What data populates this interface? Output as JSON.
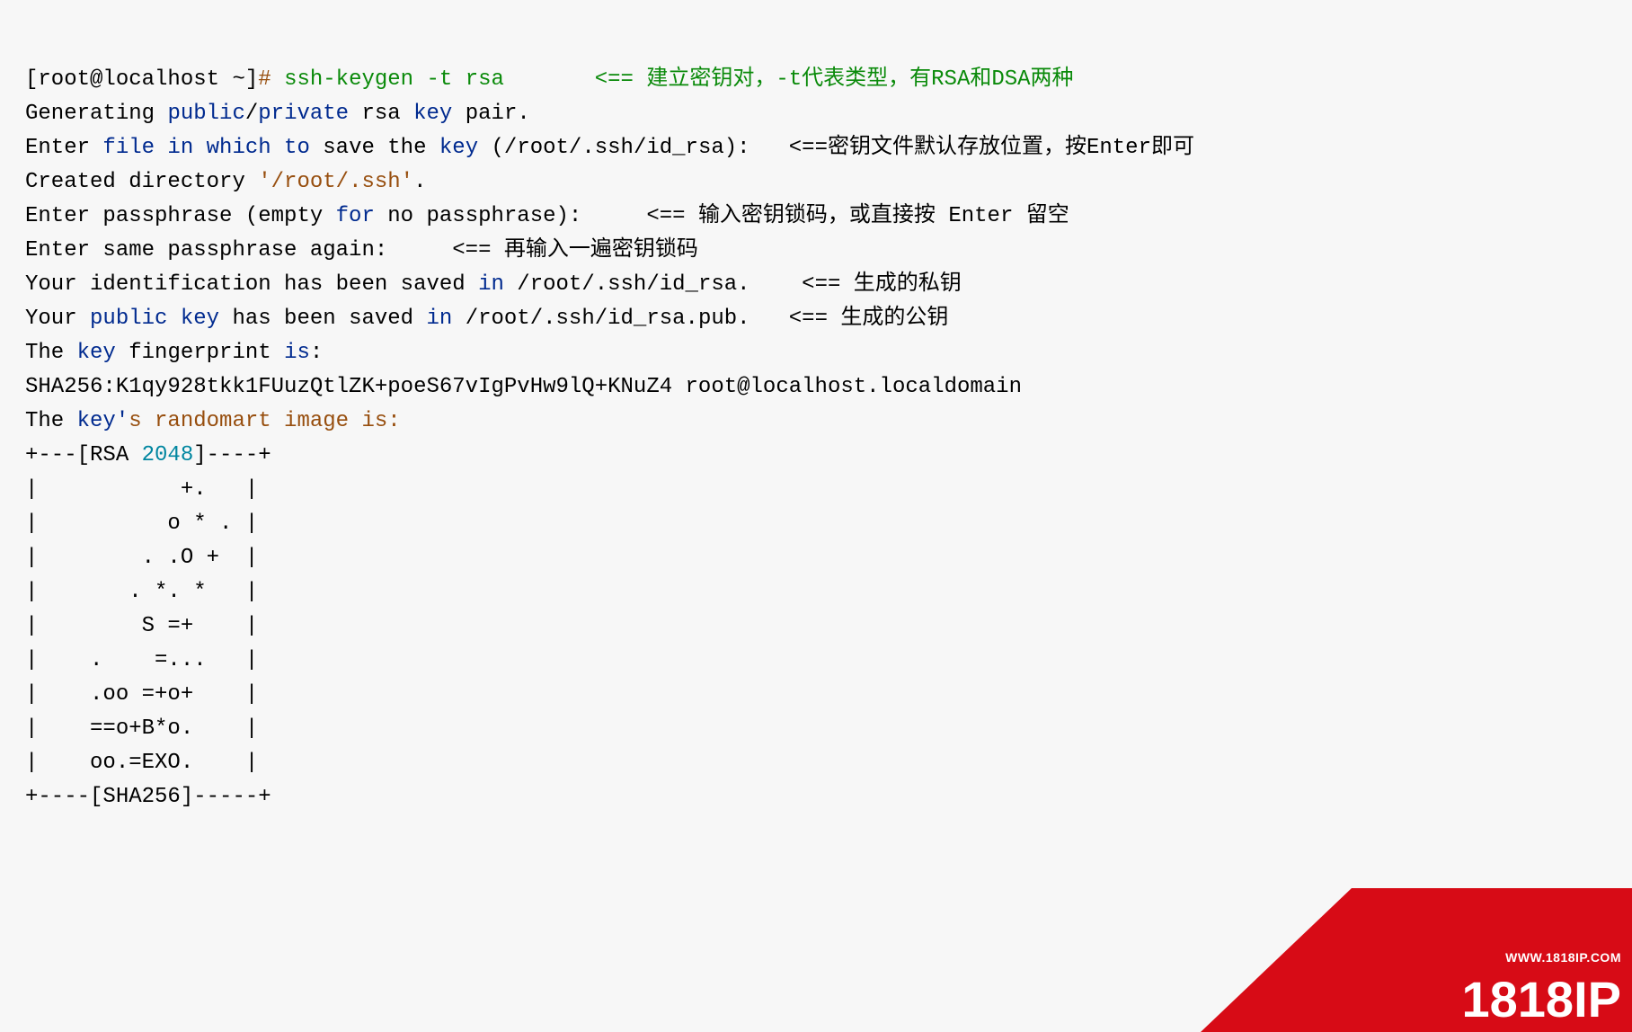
{
  "line1": {
    "a": "[root@localhost ~]",
    "b": "# ",
    "c": "ssh-keygen -t rsa",
    "d": "       ",
    "e": "<== 建立密钥对，-t代表类型，有RSA和DSA两种"
  },
  "line2": {
    "a": "Generating ",
    "b": "public",
    "c": "/",
    "d": "private",
    "e": " rsa ",
    "f": "key",
    "g": " pair."
  },
  "line3": {
    "a": "Enter ",
    "b": "file in which to",
    "c": " save the ",
    "d": "key",
    "e": " (/root/.ssh/id_rsa):   ",
    "f": "<==密钥文件默认存放位置，按Enter即可"
  },
  "line4": {
    "a": "Created directory ",
    "b": "'/root/.ssh'",
    "c": "."
  },
  "line5": {
    "a": "Enter passphrase (empty ",
    "b": "for",
    "c": " no passphrase):     ",
    "d": "<== 输入密钥锁码，或直接按 Enter 留空"
  },
  "line6": {
    "a": "Enter same passphrase again:     ",
    "b": "<== 再输入一遍密钥锁码"
  },
  "line7": {
    "a": "Your identification has been saved ",
    "b": "in",
    "c": " /root/.ssh/id_rsa.    ",
    "d": "<== 生成的私钥"
  },
  "line8": {
    "a": "Your ",
    "b": "public key",
    "c": " has been saved ",
    "d": "in",
    "e": " /root/.ssh/id_rsa.pub.   ",
    "f": "<== 生成的公钥"
  },
  "line9": {
    "a": "The ",
    "b": "key",
    "c": " fingerprint ",
    "d": "is",
    ":": ":"
  },
  "line10": "SHA256:K1qy928tkk1FUuzQtlZK+poeS67vIgPvHw9lQ+KNuZ4 root@localhost.localdomain",
  "line11": {
    "a": "The ",
    "b": "key'",
    "c": "s randomart image is:"
  },
  "art": {
    "l0": {
      "a": "+---[RSA ",
      "b": "2048",
      "c": "]----+"
    },
    "l1": "|           +.   |",
    "l2": "|          o * . |",
    "l3": "|        . .O +  |",
    "l4": "|       . *. *   |",
    "l5": "|        S =+    |",
    "l6": "|    .    =...   |",
    "l7": "|    .oo =+o+    |",
    "l8": "|    ==o+B*o.    |",
    "l9": "|    oo.=EXO.    |",
    "l10": "+----[SHA256]-----+"
  },
  "brand": {
    "url": "WWW.1818IP.COM",
    "name": "1818IP"
  }
}
